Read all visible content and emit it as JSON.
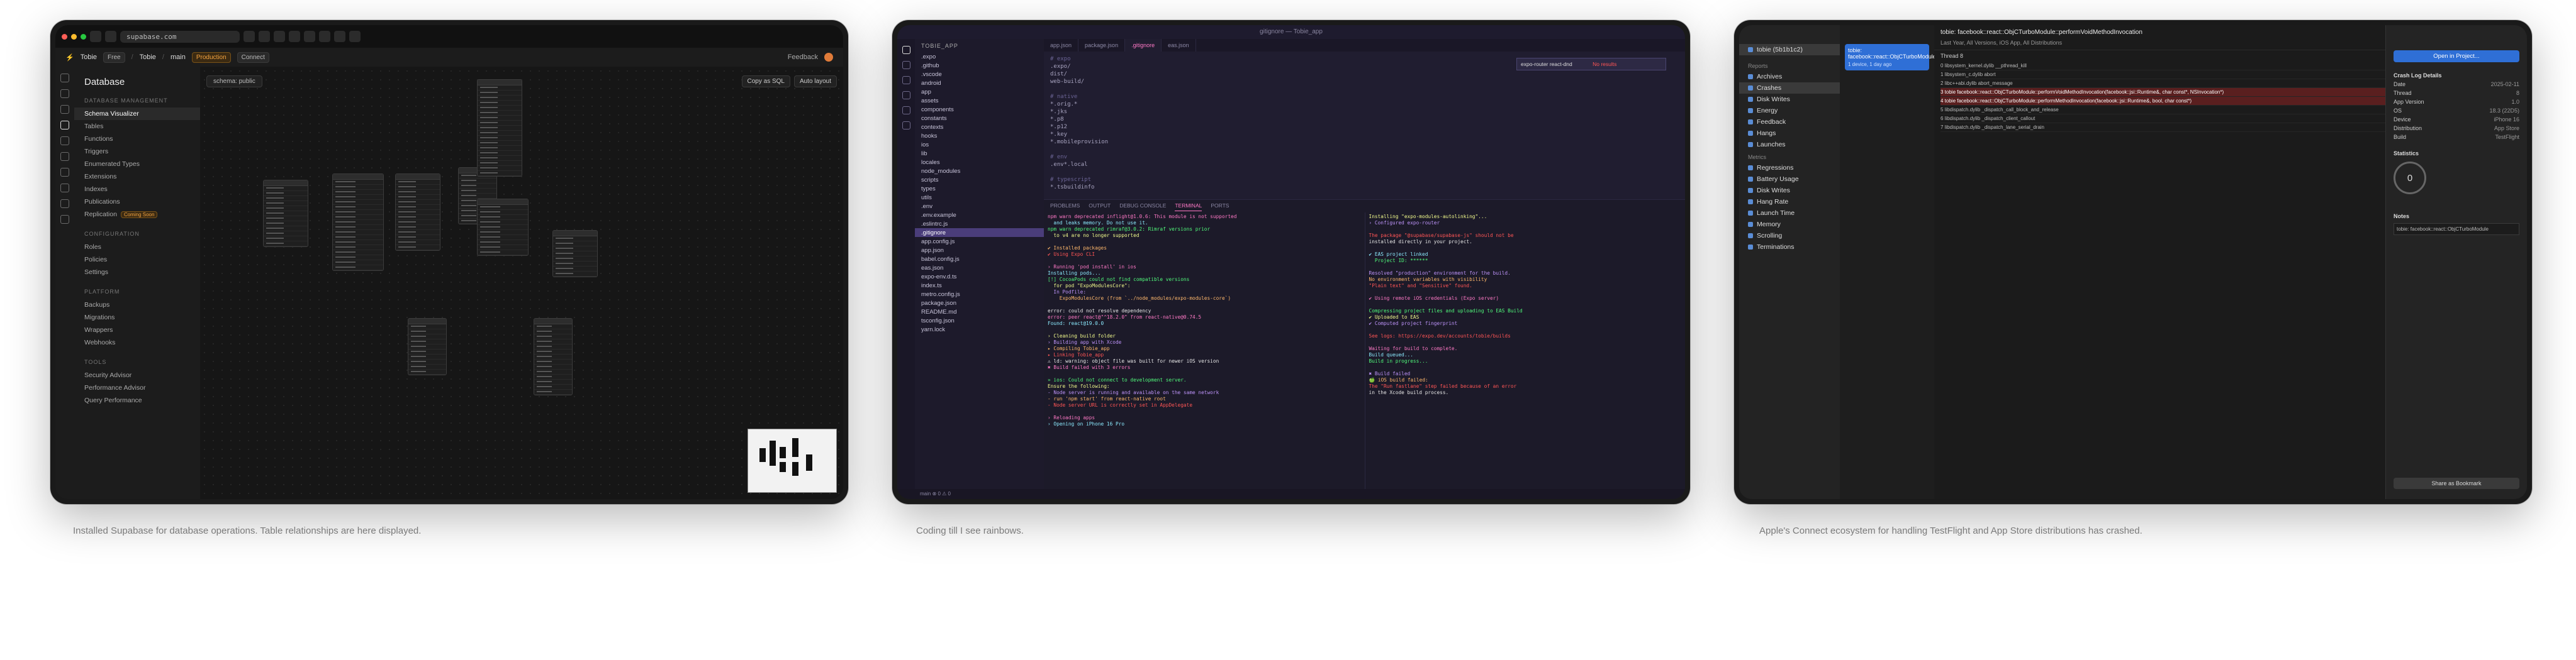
{
  "panels": [
    {
      "caption": "Installed Supabase for database operations. Table relationships are here displayed."
    },
    {
      "caption": "Coding till I see rainbows."
    },
    {
      "caption": "Apple's Connect ecosystem for handling TestFlight and App Store distributions has crashed."
    }
  ],
  "supabase": {
    "url": "supabase.com",
    "org": "Tobie",
    "plan": "Free",
    "project": "Tobie",
    "branch": "main",
    "env_badge": "Production",
    "connect_label": "Connect",
    "feedback_label": "Feedback",
    "title": "Database",
    "sections": [
      {
        "label": "DATABASE MANAGEMENT",
        "items": [
          "Schema Visualizer",
          "Tables",
          "Functions",
          "Triggers",
          "Enumerated Types",
          "Extensions",
          "Indexes",
          "Publications",
          "Replication"
        ]
      },
      {
        "label": "CONFIGURATION",
        "items": [
          "Roles",
          "Policies",
          "Settings"
        ]
      },
      {
        "label": "PLATFORM",
        "items": [
          "Backups",
          "Migrations",
          "Wrappers",
          "Webhooks"
        ]
      },
      {
        "label": "TOOLS",
        "items": [
          "Security Advisor",
          "Performance Advisor",
          "Query Performance"
        ]
      }
    ],
    "replication_badge": "Coming Soon",
    "schema_label": "schema: public",
    "copy_sql_label": "Copy as SQL",
    "auto_layout_label": "Auto layout"
  },
  "vscode": {
    "window_title": "gitignore — Tobie_app",
    "explorer_title": "TOBIE_APP",
    "files": [
      ".expo",
      ".github",
      ".vscode",
      "android",
      "app",
      "assets",
      "components",
      "constants",
      "contexts",
      "hooks",
      "ios",
      "lib",
      "locales",
      "node_modules",
      "scripts",
      "types",
      "utils",
      ".env",
      ".env.example",
      ".eslintrc.js",
      ".gitignore",
      "app.config.js",
      "app.json",
      "babel.config.js",
      "eas.json",
      "expo-env.d.ts",
      "index.ts",
      "metro.config.js",
      "package.json",
      "README.md",
      "tsconfig.json",
      "yarn.lock"
    ],
    "selected_file": ".gitignore",
    "tabs": [
      "app.json",
      "package.json",
      ".gitignore",
      "eas.json"
    ],
    "active_tab": ".gitignore",
    "code_lines": [
      "# expo",
      ".expo/",
      "dist/",
      "web-build/",
      "",
      "# native",
      "*.orig.*",
      "*.jks",
      "*.p8",
      "*.p12",
      "*.key",
      "*.mobileprovision",
      "",
      "# env",
      ".env*.local",
      "",
      "# typescript",
      "*.tsbuildinfo"
    ],
    "find_placeholder": "expo-router react-dnd",
    "find_result": "No results",
    "panel_tabs": [
      "PROBLEMS",
      "OUTPUT",
      "DEBUG CONSOLE",
      "TERMINAL",
      "PORTS"
    ],
    "terminal_left": [
      "npm warn deprecated inflight@1.0.6: This module is not supported",
      "  and leaks memory. Do not use it.",
      "npm warn deprecated rimraf@3.0.2: Rimraf versions prior",
      "  to v4 are no longer supported",
      "",
      "✔ Installed packages",
      "✔ Using Expo CLI",
      "",
      "› Running 'pod install' in ios",
      "Installing pods...",
      "[!] CocoaPods could not find compatible versions",
      "  for pod \"ExpoModulesCore\":",
      "  In Podfile:",
      "    ExpoModulesCore (from `../node_modules/expo-modules-core`)",
      "",
      "error: could not resolve dependency",
      "error: peer react@\"^18.2.0\" from react-native@0.74.5",
      "Found: react@19.0.0",
      "",
      "› Cleaning build folder",
      "› Building app with Xcode",
      "▸ Compiling Tobie_app",
      "▸ Linking Tobie_app",
      "⚠ ld: warning: object file was built for newer iOS version",
      "✖ Build failed with 3 errors",
      "",
      "» ios: Could not connect to development server.",
      "Ensure the following:",
      "- Node server is running and available on the same network",
      "- run 'npm start' from react-native root",
      "- Node server URL is correctly set in AppDelegate",
      "",
      "› Reloading apps",
      "› Opening on iPhone 16 Pro"
    ],
    "terminal_right": [
      "Installing \"expo-modules-autolinking\"...",
      "› Configured expo-router",
      "",
      "The package \"@supabase/supabase-js\" should not be",
      "installed directly in your project.",
      "",
      "✔ EAS project linked",
      "  Project ID: ******",
      "",
      "Resolved \"production\" environment for the build.",
      "No environment variables with visibility",
      "\"Plain text\" and \"Sensitive\" found.",
      "",
      "✔ Using remote iOS credentials (Expo server)",
      "",
      "Compressing project files and uploading to EAS Build",
      "✔ Uploaded to EAS",
      "✔ Computed project fingerprint",
      "",
      "See logs: https://expo.dev/accounts/tobie/builds",
      "",
      "Waiting for build to complete.",
      "Build queued...",
      "Build in progress...",
      "",
      "✖ Build failed",
      "🍏 iOS build failed:",
      "The \"Run fastlane\" step failed because of an error",
      "in the Xcode build process."
    ],
    "status": "main  ⊗ 0 ⚠ 0"
  },
  "xcode": {
    "app": "tobie (5b1b1c2)",
    "sections": [
      {
        "label": "Reports",
        "items": [
          "Archives",
          "Crashes",
          "Disk Writes",
          "Energy",
          "Feedback",
          "Hangs",
          "Launches"
        ]
      },
      {
        "label": "Metrics",
        "items": [
          "Regressions",
          "Battery Usage",
          "Disk Writes",
          "Hang Rate",
          "Launch Time",
          "Memory",
          "Scrolling",
          "Terminations"
        ]
      }
    ],
    "selected_item": "Crashes",
    "crash_title": "tobie: facebook::react::ObjCTurboModule::performVoidMethodInvocation",
    "crash_meta": "1 device, 1 day ago",
    "filter_label": "Last Year, All Versions, iOS App, All Distributions",
    "thread_label": "Thread 8",
    "stack_rows": [
      "0  libsystem_kernel.dylib  __pthread_kill",
      "1  libsystem_c.dylib  abort",
      "2  libc++abi.dylib  abort_message",
      "3  tobie  facebook::react::ObjCTurboModule::performVoidMethodInvocation(facebook::jsi::Runtime&, char const*, NSInvocation*)",
      "4  tobie  facebook::react::ObjCTurboModule::performMethodInvocation(facebook::jsi::Runtime&, bool, char const*)",
      "5  libdispatch.dylib  _dispatch_call_block_and_release",
      "6  libdispatch.dylib  _dispatch_client_callout",
      "7  libdispatch.dylib  _dispatch_lane_serial_drain"
    ],
    "open_button": "Open in Project...",
    "details": [
      [
        "Crash Log Details",
        ""
      ],
      [
        "Date",
        "2025-02-11"
      ],
      [
        "Thread",
        "8"
      ],
      [
        "App Version",
        "1.0"
      ],
      [
        "OS",
        "18.3 (22D5)"
      ],
      [
        "Device",
        "iPhone 16"
      ],
      [
        "Distribution",
        "App Store"
      ],
      [
        "Build",
        "TestFlight"
      ]
    ],
    "stats_title": "Statistics",
    "stats_value": "0",
    "notes_title": "Notes",
    "notes_value": "tobie: facebook::react::ObjCTurboModule",
    "share_button": "Share as Bookmark"
  }
}
